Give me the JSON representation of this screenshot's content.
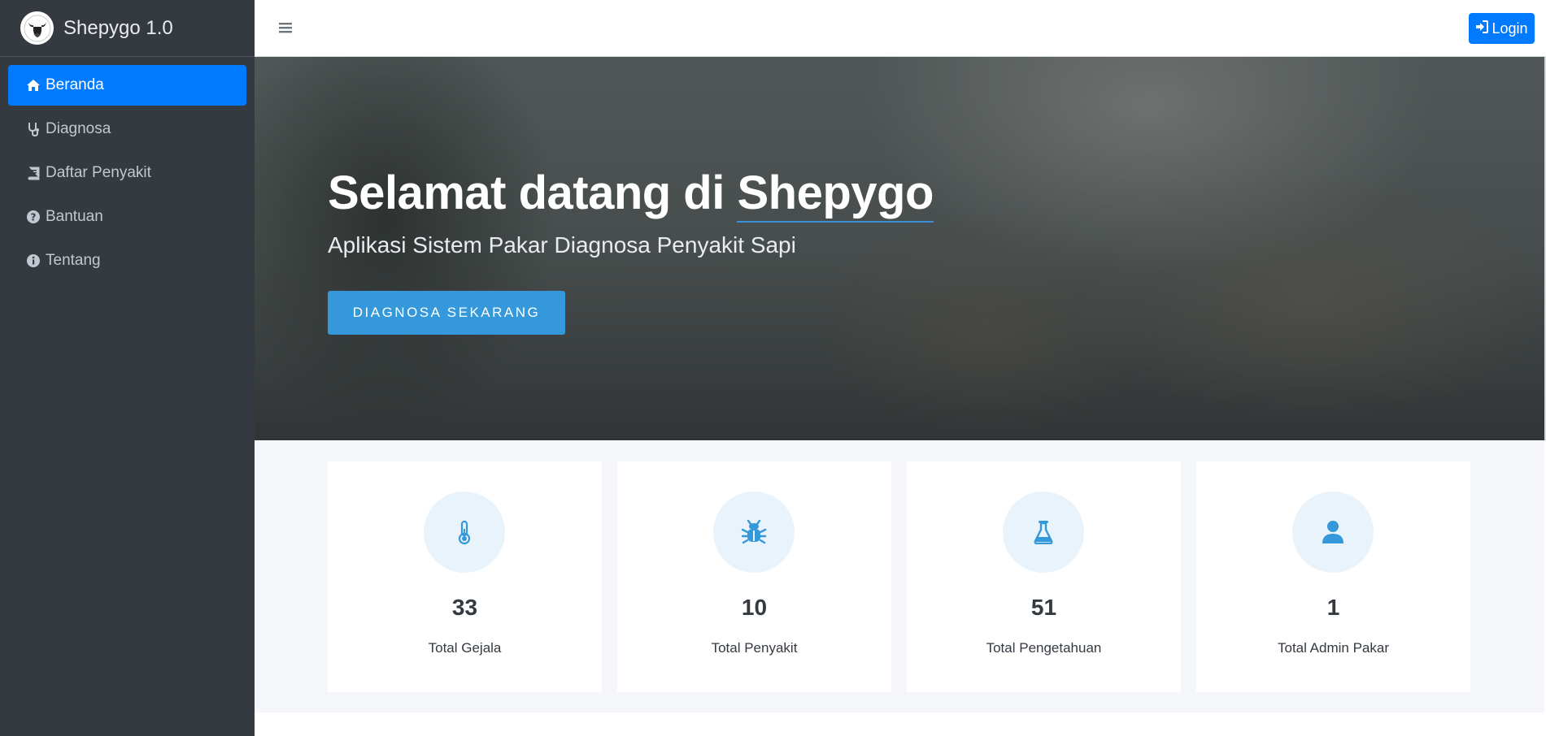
{
  "brand": {
    "name": "Shepygo 1.0",
    "logo_icon": "bull-head-logo"
  },
  "sidebar": {
    "items": [
      {
        "label": "Beranda",
        "icon": "home-icon",
        "active": true
      },
      {
        "label": "Diagnosa",
        "icon": "stethoscope-icon",
        "active": false
      },
      {
        "label": "Daftar Penyakit",
        "icon": "book-icon",
        "active": false
      },
      {
        "label": "Bantuan",
        "icon": "question-circle-icon",
        "active": false
      },
      {
        "label": "Tentang",
        "icon": "info-circle-icon",
        "active": false
      }
    ]
  },
  "topbar": {
    "menu_icon": "hamburger-icon",
    "login_label": "Login",
    "login_icon": "sign-in-icon"
  },
  "hero": {
    "title_prefix": "Selamat datang di ",
    "title_highlight": "Shepygo",
    "subtitle": "Aplikasi Sistem Pakar Diagnosa Penyakit Sapi",
    "cta_label": "DIAGNOSA SEKARANG"
  },
  "stats": [
    {
      "value": "33",
      "label": "Total Gejala",
      "icon": "thermometer-icon"
    },
    {
      "value": "10",
      "label": "Total Penyakit",
      "icon": "bug-icon"
    },
    {
      "value": "51",
      "label": "Total Pengetahuan",
      "icon": "flask-icon"
    },
    {
      "value": "1",
      "label": "Total Admin Pakar",
      "icon": "user-icon"
    }
  ],
  "colors": {
    "primary": "#007bff",
    "accent": "#3498db",
    "sidebar": "#343a40",
    "icon_bg": "#e9f3fb"
  }
}
